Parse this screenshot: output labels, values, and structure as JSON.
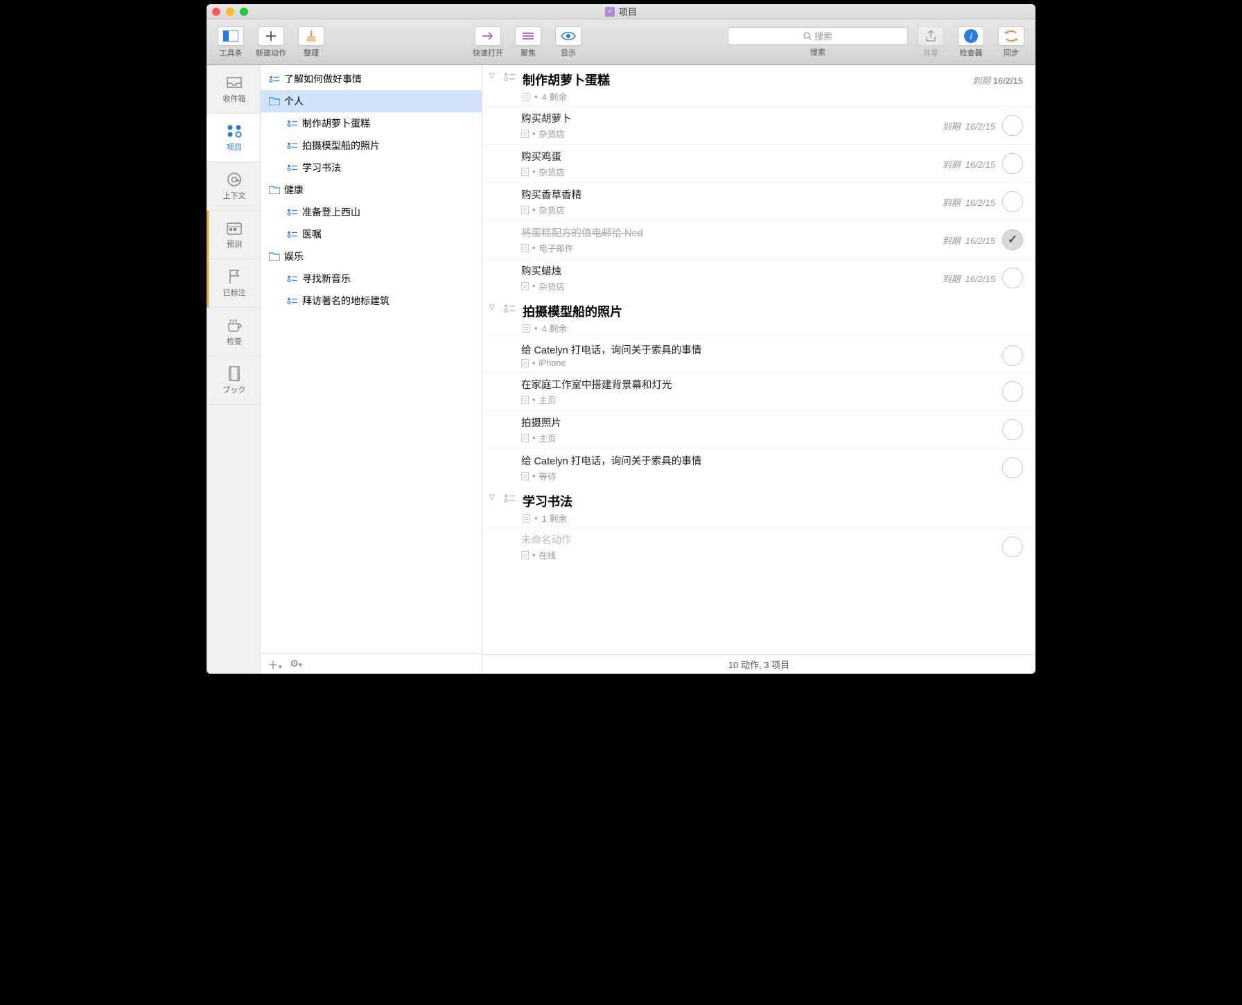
{
  "window": {
    "title": "项目"
  },
  "toolbar": {
    "buttons": [
      {
        "label": "工具条"
      },
      {
        "label": "新建动作"
      },
      {
        "label": "整理"
      },
      {
        "label": "快速打开"
      },
      {
        "label": "聚焦"
      },
      {
        "label": "显示"
      },
      {
        "label": "共享"
      },
      {
        "label": "检查器"
      },
      {
        "label": "同步"
      }
    ],
    "search_placeholder": "搜索",
    "search_label": "搜索"
  },
  "tabs": [
    {
      "label": "收件箱"
    },
    {
      "label": "项目"
    },
    {
      "label": "上下文"
    },
    {
      "label": "预测"
    },
    {
      "label": "已标注"
    },
    {
      "label": "检查"
    },
    {
      "label": "ブック"
    }
  ],
  "outline": [
    {
      "type": "proj",
      "depth": 0,
      "label": "了解如何做好事情"
    },
    {
      "type": "folder",
      "depth": 0,
      "label": "个人",
      "selected": true
    },
    {
      "type": "proj",
      "depth": 1,
      "label": "制作胡萝卜蛋糕"
    },
    {
      "type": "proj",
      "depth": 1,
      "label": "拍摄模型船的照片"
    },
    {
      "type": "proj",
      "depth": 1,
      "label": "学习书法"
    },
    {
      "type": "folder",
      "depth": 0,
      "label": "健康"
    },
    {
      "type": "proj",
      "depth": 1,
      "label": "准备登上西山"
    },
    {
      "type": "proj",
      "depth": 1,
      "label": "医嘱"
    },
    {
      "type": "folder",
      "depth": 0,
      "label": "娱乐"
    },
    {
      "type": "proj",
      "depth": 1,
      "label": "寻找新音乐"
    },
    {
      "type": "proj",
      "depth": 1,
      "label": "拜访著名的地标建筑"
    }
  ],
  "footer_add": "+",
  "footer_gear": "⚙",
  "projects": [
    {
      "title": "制作胡萝卜蛋糕",
      "remaining": "4 剩余",
      "due_prefix": "到期",
      "due": "16/2/15",
      "tasks": [
        {
          "title": "购买胡萝卜",
          "context": "杂货店",
          "due": "16/2/15"
        },
        {
          "title": "购买鸡蛋",
          "context": "杂货店",
          "due": "16/2/15"
        },
        {
          "title": "购买香草香精",
          "context": "杂货店",
          "due": "16/2/15"
        },
        {
          "title": "将蛋糕配方的值电邮给 Ned",
          "context": "电子邮件",
          "due": "16/2/15",
          "done": true
        },
        {
          "title": "购买蜡烛",
          "context": "杂货店",
          "due": "16/2/15"
        }
      ]
    },
    {
      "title": "拍摄模型船的照片",
      "remaining": "4 剩余",
      "tasks": [
        {
          "title": "给 Catelyn 打电话，询问关于索具的事情",
          "context": "iPhone"
        },
        {
          "title": "在家庭工作室中搭建背景幕和灯光",
          "context": "主页"
        },
        {
          "title": "拍摄照片",
          "context": "主页"
        },
        {
          "title": "给 Catelyn 打电话，询问关于索具的事情",
          "context": "等待"
        }
      ]
    },
    {
      "title": "学习书法",
      "remaining": "1 剩余",
      "tasks": [
        {
          "title": "未命名动作",
          "context": "在线",
          "ghost": true
        }
      ]
    }
  ],
  "status": "10 动作, 3 项目",
  "meta_sep": "•"
}
